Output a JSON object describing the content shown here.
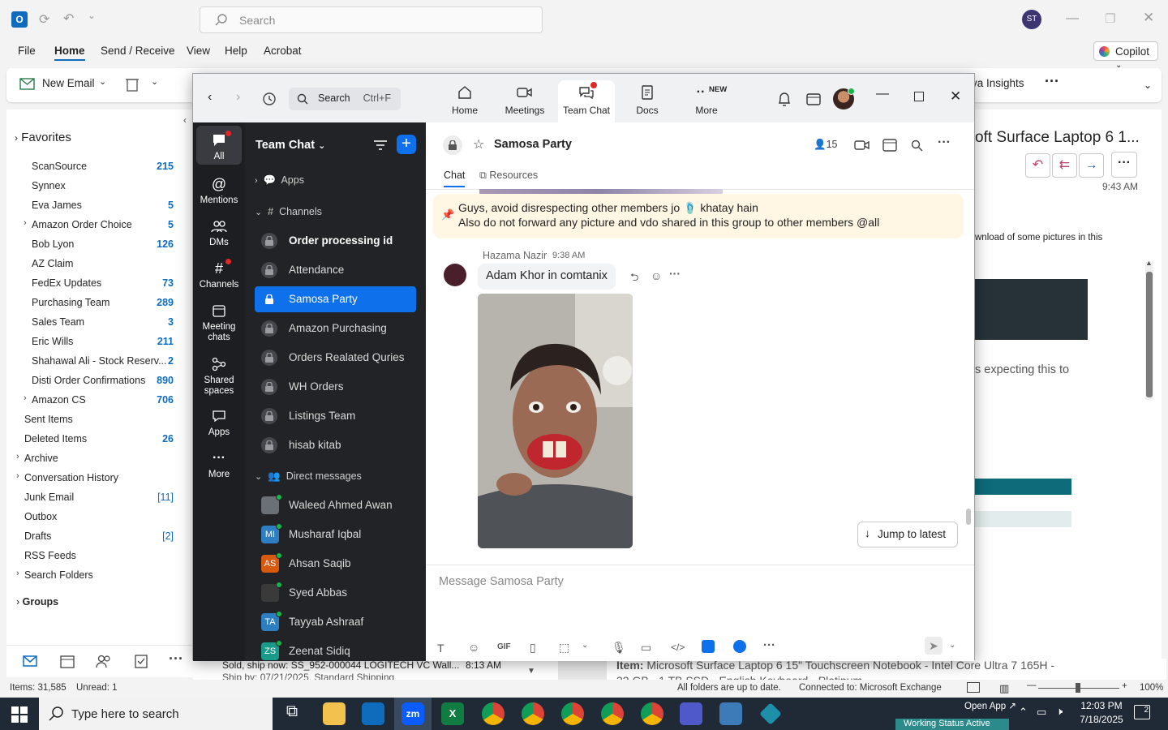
{
  "outlook": {
    "search_placeholder": "Search",
    "avatar_initials": "ST",
    "menu": [
      "File",
      "Home",
      "Send / Receive",
      "View",
      "Help",
      "Acrobat"
    ],
    "copilot_label": "Copilot",
    "ribbon_new_email": "New Email",
    "ribbon_insights": "va Insights",
    "favorites_label": "Favorites",
    "folders": [
      {
        "name": "ScanSource",
        "count": "215"
      },
      {
        "name": "Synnex",
        "count": ""
      },
      {
        "name": "Eva James",
        "count": "5"
      },
      {
        "name": "Amazon Order Choice",
        "count": "5"
      },
      {
        "name": "Bob Lyon",
        "count": "126"
      },
      {
        "name": "AZ Claim",
        "count": ""
      },
      {
        "name": "FedEx Updates",
        "count": "73"
      },
      {
        "name": "Purchasing Team",
        "count": "289"
      },
      {
        "name": "Sales Team",
        "count": "3"
      },
      {
        "name": "Eric Wills",
        "count": "211"
      },
      {
        "name": "Shahawal Ali - Stock Reserv...",
        "count": "2"
      },
      {
        "name": "Disti Order Confirmations",
        "count": "890"
      },
      {
        "name": "Amazon CS",
        "count": "706"
      },
      {
        "name": "Sent Items",
        "count": ""
      },
      {
        "name": "Deleted Items",
        "count": "26"
      },
      {
        "name": "Archive",
        "count": ""
      },
      {
        "name": "Conversation History",
        "count": ""
      },
      {
        "name": "Junk Email",
        "count": "[11]"
      },
      {
        "name": "Outbox",
        "count": ""
      },
      {
        "name": "Drafts",
        "count": "[2]"
      },
      {
        "name": "RSS Feeds",
        "count": ""
      },
      {
        "name": "Search Folders",
        "count": ""
      }
    ],
    "groups_label": "Groups",
    "reading_title": "oft Surface Laptop 6 1...",
    "reading_time": "9:43 AM",
    "reading_text1": "wnload of some pictures in this",
    "reading_text2": "s expecting this to",
    "mail_preview_line1": "Sold, ship now: SS_952-000044 LOGITECH VC Wall...",
    "mail_preview_time": "8:13 AM",
    "mail_preview_line2": "Ship by: 07/21/2025, Standard Shipping",
    "item_label": "Item:",
    "item_text": "Microsoft Surface Laptop 6 15\" Touchscreen Notebook - Intel Core Ultra 7 165H -",
    "item_text2": "32 GB - 1 TB SSD - English Keyboard - Platinum",
    "status_items": "Items: 31,585",
    "status_unread": "Unread: 1",
    "status_folders": "All folders are up to date.",
    "status_connected": "Connected to: Microsoft Exchange",
    "zoom_level": "100%"
  },
  "taskbar": {
    "search_placeholder": "Type here to search",
    "time": "12:03 PM",
    "date": "7/18/2025",
    "open_app_tooltip": "Open App",
    "working_status": "Working Status Active",
    "notification_count": "2"
  },
  "zoom": {
    "search_label": "Search",
    "search_shortcut": "Ctrl+F",
    "tabs": [
      {
        "label": "Home",
        "icon": "home-icon"
      },
      {
        "label": "Meetings",
        "icon": "video-camera-icon"
      },
      {
        "label": "Team Chat",
        "icon": "chat-bubbles-icon"
      },
      {
        "label": "Docs",
        "icon": "document-icon"
      },
      {
        "label": "More",
        "icon": "more-dots-icon"
      }
    ],
    "new_badge": "NEW",
    "rail": [
      {
        "label": "All"
      },
      {
        "label": "Mentions"
      },
      {
        "label": "DMs"
      },
      {
        "label": "Channels"
      },
      {
        "label": "Meeting chats"
      },
      {
        "label": "Shared spaces"
      },
      {
        "label": "Apps"
      },
      {
        "label": "More"
      }
    ],
    "list_title": "Team Chat",
    "apps_label": "Apps",
    "channels_label": "Channels",
    "channels": [
      {
        "name": "Order processing id"
      },
      {
        "name": "Attendance"
      },
      {
        "name": "Samosa Party"
      },
      {
        "name": "Amazon Purchasing"
      },
      {
        "name": "Orders Realated Quries"
      },
      {
        "name": "WH Orders"
      },
      {
        "name": "Listings Team"
      },
      {
        "name": "hisab kitab"
      }
    ],
    "dm_label": "Direct messages",
    "dms": [
      {
        "name": "Waleed Ahmed Awan",
        "initials": "",
        "color": "#6b6f76"
      },
      {
        "name": "Musharaf Iqbal",
        "initials": "MI",
        "color": "#2d7fc1"
      },
      {
        "name": "Ahsan Saqib",
        "initials": "AS",
        "color": "#d9590f"
      },
      {
        "name": "Syed Abbas",
        "initials": "",
        "color": "#3a3a3a"
      },
      {
        "name": "Tayyab Ashraaf",
        "initials": "TA",
        "color": "#2d7fc1"
      },
      {
        "name": "Zeenat Sidiq",
        "initials": "ZS",
        "color": "#1a9a8a"
      }
    ],
    "chat": {
      "channel_name": "Samosa Party",
      "member_count": "15",
      "tab_chat": "Chat",
      "tab_resources": "Resources",
      "pinned_line1": "Guys, avoid disrespecting other members jo 🩴 khatay hain",
      "pinned_line2": "Also do not forward any picture and vdo shared in this group to other members @all",
      "sender": "Hazama Nazir",
      "time": "9:38 AM",
      "message": "Adam Khor in comtanix",
      "jump_label": "Jump to latest",
      "composer_placeholder": "Message Samosa Party"
    }
  }
}
